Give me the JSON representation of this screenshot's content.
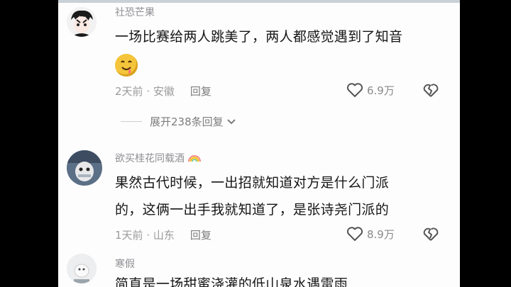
{
  "comments": [
    {
      "username": "社恐芒果",
      "text": "一场比赛给两人跳美了，两人都感觉遇到了知音",
      "time": "2天前",
      "location": "安徽",
      "reply_label": "回复",
      "likes": "6.9万",
      "emoji": "drooling-face-emoji",
      "expand_label": "展开238条回复"
    },
    {
      "username": "欲买桂花同载酒",
      "text_line1": "果然古代时候，一出招就知道对方是什么门派",
      "text_line2": "的，这俩一出手我就知道了，是张诗尧门派的",
      "time": "1天前",
      "location": "山东",
      "reply_label": "回复",
      "likes": "8.9万"
    },
    {
      "username": "寒假",
      "text": "简直是一场甜蜜浇灌的低山泉水遇雷雨"
    }
  ],
  "icons": [
    "avatar",
    "heart-icon",
    "broken-heart-icon",
    "chevron-down-icon",
    "rainbow-icon"
  ],
  "separator": " · "
}
